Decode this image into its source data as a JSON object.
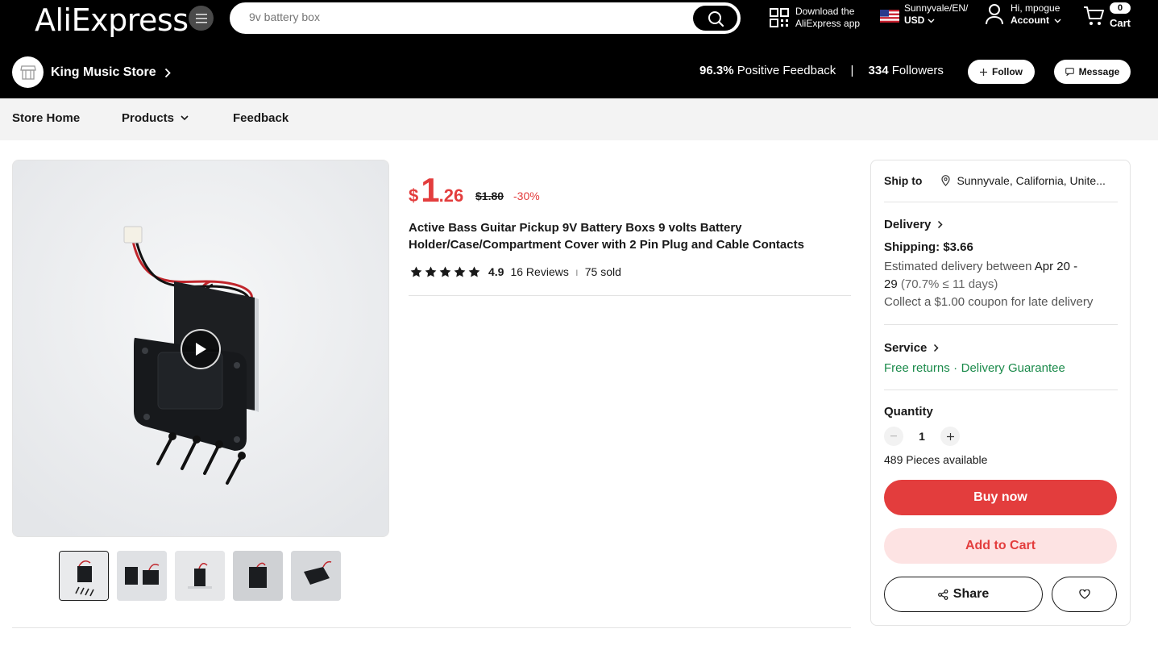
{
  "header": {
    "logo": "AliExpress",
    "search_placeholder": "9v battery box",
    "app_line1": "Download the",
    "app_line2": "AliExpress app",
    "locale_line1": "Sunnyvale/EN/",
    "locale_line2": "USD",
    "account_line1": "Hi, mpogue",
    "account_line2": "Account",
    "cart_count": "0",
    "cart_label": "Cart"
  },
  "store": {
    "name": "King Music Store",
    "feedback_value": "96.3%",
    "feedback_label": "Positive Feedback",
    "separator": "|",
    "followers_value": "334",
    "followers_label": "Followers",
    "follow_label": "Follow",
    "message_label": "Message"
  },
  "store_nav": {
    "home": "Store Home",
    "products": "Products",
    "feedback": "Feedback"
  },
  "product": {
    "currency": "$",
    "price_int": "1",
    "price_dec": ".26",
    "old_price": "$1.80",
    "discount": "-30%",
    "title": "Active Bass Guitar Pickup 9V Battery Boxs 9 volts Battery Holder/Case/Compartment Cover with 2 Pin Plug and Cable Contacts",
    "rating": "4.9",
    "stars": 5,
    "reviews": "16 Reviews",
    "rating_sep": "ı",
    "sold": "75 sold",
    "thumbnail_count": 5
  },
  "panel": {
    "ship_to_label": "Ship to",
    "ship_to_value": "Sunnyvale, California, Unite...",
    "delivery_label": "Delivery",
    "shipping": "Shipping: $3.66",
    "est_prefix": "Estimated delivery between",
    "est_dates_a": "Apr 20 -",
    "est_dates_b": "29",
    "est_note": "(70.7% ≤ 11 days)",
    "coupon": "Collect a $1.00 coupon for late delivery",
    "service_label": "Service",
    "free_returns": "Free returns",
    "service_dot": "·",
    "guarantee": "Delivery Guarantee",
    "quantity_label": "Quantity",
    "quantity_value": "1",
    "available": "489 Pieces available",
    "buy_now": "Buy now",
    "add_to_cart": "Add to Cart",
    "share": "Share"
  },
  "colors": {
    "brand_red": "#e33d3d",
    "green": "#1a8a4a",
    "header_bg": "#000000"
  },
  "icons": [
    "menu-icon",
    "search-icon",
    "qr-code-icon",
    "us-flag-icon",
    "user-icon",
    "cart-icon",
    "chevron-right-icon",
    "plus-icon",
    "message-icon",
    "chevron-down-icon",
    "play-icon",
    "star-icon",
    "location-pin-icon",
    "share-icon",
    "heart-icon"
  ]
}
